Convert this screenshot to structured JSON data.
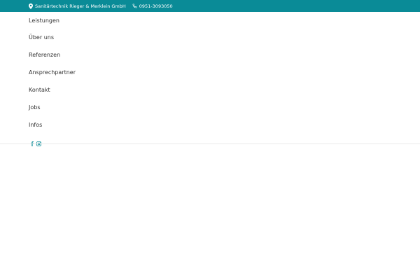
{
  "topbar": {
    "address": "Sanitärtechnik Rieger & Merklein GmbH",
    "address_icon": "location-pin-icon",
    "phone": "0951-3093050",
    "phone_icon": "phone-icon",
    "background": "#0a8b97"
  },
  "menu": {
    "items": [
      {
        "label": "Leistungen"
      },
      {
        "label": "Über uns"
      },
      {
        "label": "Referenzen"
      },
      {
        "label": "Ansprechpartner"
      },
      {
        "label": "Kontakt"
      },
      {
        "label": "Jobs"
      },
      {
        "label": "Infos"
      }
    ]
  },
  "social": {
    "icons": [
      "facebook-icon",
      "instagram-icon"
    ],
    "color": "#0a8b97"
  }
}
